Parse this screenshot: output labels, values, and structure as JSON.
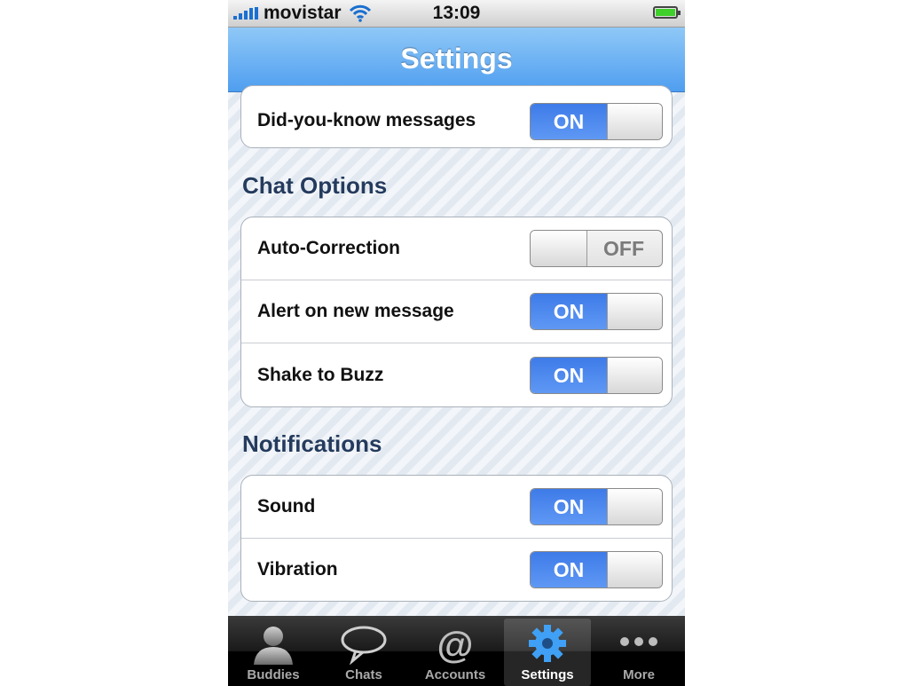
{
  "status_bar": {
    "carrier": "movistar",
    "time": "13:09"
  },
  "nav": {
    "title": "Settings"
  },
  "top_group": {
    "rows": [
      {
        "label": "Did-you-know messages",
        "state": "ON"
      }
    ]
  },
  "chat_options": {
    "header": "Chat Options",
    "rows": [
      {
        "label": "Auto-Correction",
        "state": "OFF"
      },
      {
        "label": "Alert on new message",
        "state": "ON"
      },
      {
        "label": "Shake to Buzz",
        "state": "ON"
      }
    ]
  },
  "notifications": {
    "header": "Notifications",
    "rows": [
      {
        "label": "Sound",
        "state": "ON"
      },
      {
        "label": "Vibration",
        "state": "ON"
      }
    ]
  },
  "tab_bar": {
    "tabs": [
      {
        "label": "Buddies",
        "icon": "person-icon"
      },
      {
        "label": "Chats",
        "icon": "speech-bubble-icon"
      },
      {
        "label": "Accounts",
        "icon": "at-sign-icon"
      },
      {
        "label": "Settings",
        "icon": "gear-icon",
        "selected": true
      },
      {
        "label": "More",
        "icon": "more-dots-icon"
      }
    ]
  },
  "colors": {
    "accent": "#4f9ef0",
    "toggle_on": "#3e7be8",
    "section_header": "#243b5e"
  }
}
